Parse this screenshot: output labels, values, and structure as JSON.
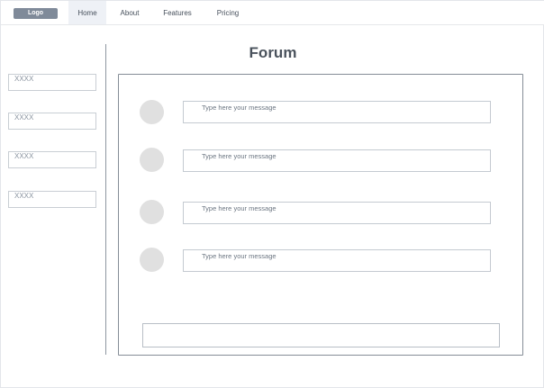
{
  "header": {
    "logo_label": "Logo",
    "nav": [
      {
        "label": "Home",
        "active": true
      },
      {
        "label": "About",
        "active": false
      },
      {
        "label": "Features",
        "active": false
      },
      {
        "label": "Pricing",
        "active": false
      }
    ]
  },
  "sidebar": {
    "items": [
      {
        "label": "XXXX"
      },
      {
        "label": "XXXX"
      },
      {
        "label": "XXXX"
      },
      {
        "label": "XXXX"
      }
    ]
  },
  "main": {
    "title": "Forum",
    "messages": [
      {
        "placeholder": "Type here your message"
      },
      {
        "placeholder": "Type here your message"
      },
      {
        "placeholder": "Type here your message"
      },
      {
        "placeholder": "Type here your message"
      }
    ],
    "compose": {
      "value": ""
    }
  },
  "colors": {
    "logo_bg": "#7f8a99",
    "active_nav_bg": "#eef1f6",
    "avatar": "#e0e0e0",
    "panel_border": "#858d97"
  }
}
